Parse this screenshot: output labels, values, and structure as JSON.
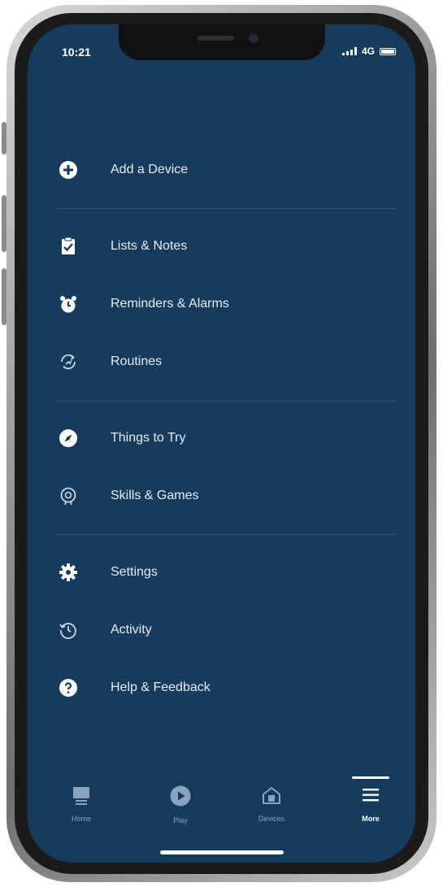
{
  "status_bar": {
    "time": "10:21",
    "network": "4G"
  },
  "menu": {
    "items": [
      {
        "label": "Add a Device",
        "icon": "plus-circle-icon"
      },
      {
        "label": "Lists & Notes",
        "icon": "clipboard-check-icon"
      },
      {
        "label": "Reminders & Alarms",
        "icon": "alarm-clock-icon"
      },
      {
        "label": "Routines",
        "icon": "routines-icon"
      },
      {
        "label": "Things to Try",
        "icon": "compass-icon"
      },
      {
        "label": "Skills & Games",
        "icon": "skills-icon"
      },
      {
        "label": "Settings",
        "icon": "gear-icon"
      },
      {
        "label": "Activity",
        "icon": "history-icon"
      },
      {
        "label": "Help & Feedback",
        "icon": "help-circle-icon"
      }
    ]
  },
  "tabbar": {
    "tabs": [
      {
        "label": "Home",
        "icon": "home-icon",
        "active": false
      },
      {
        "label": "Play",
        "icon": "play-icon",
        "active": false
      },
      {
        "label": "Devices",
        "icon": "devices-icon",
        "active": false
      },
      {
        "label": "More",
        "icon": "more-menu-icon",
        "active": true
      }
    ]
  },
  "colors": {
    "background": "#163b5c",
    "text": "#e6ecf2",
    "divider": "#2f5477",
    "tab_inactive": "#8aa4bf"
  }
}
